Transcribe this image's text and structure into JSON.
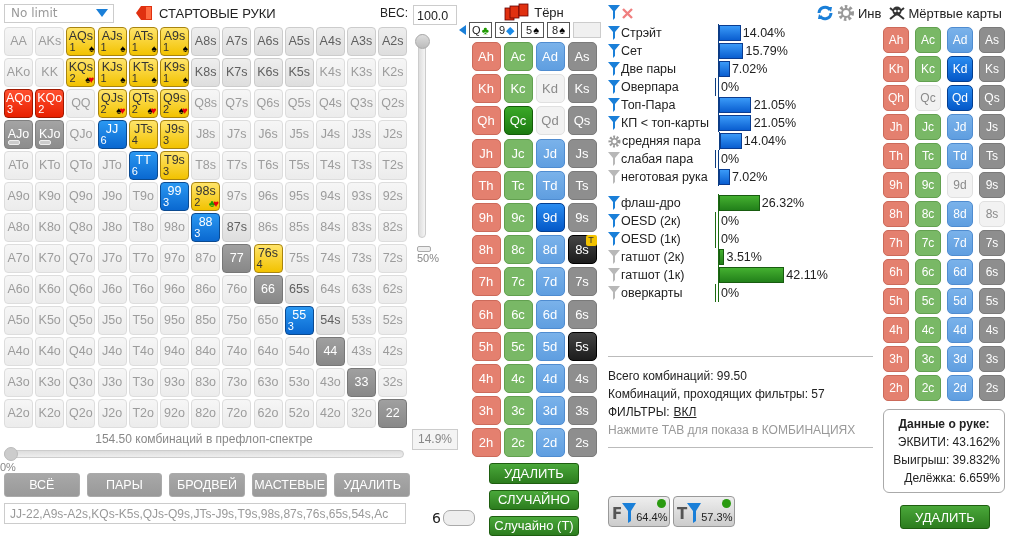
{
  "game_select": {
    "value": "No limit"
  },
  "range_title": "СТАРТОВЫЕ РУКИ",
  "weight": {
    "label": "ВЕС:",
    "value": "100.0"
  },
  "weight_slider": {
    "level": 1,
    "reading": "50%"
  },
  "grid": [
    [
      {
        "label": "AA",
        "kind": "out"
      },
      {
        "label": "AKs",
        "kind": "out"
      },
      {
        "label": "AQs",
        "kind": "made",
        "count": "1",
        "suits": [
          {
            "symbol": "♠",
            "color": "#000000"
          }
        ]
      },
      {
        "label": "AJs",
        "kind": "made",
        "count": "1",
        "suits": [
          {
            "symbol": "♠",
            "color": "#000000"
          }
        ]
      },
      {
        "label": "ATs",
        "kind": "made",
        "count": "1",
        "suits": [
          {
            "symbol": "♠",
            "color": "#000000"
          }
        ]
      },
      {
        "label": "A9s",
        "kind": "made",
        "count": "1",
        "suits": [
          {
            "symbol": "♠",
            "color": "#000000"
          }
        ]
      },
      {
        "label": "A8s",
        "kind": "in"
      },
      {
        "label": "A7s",
        "kind": "in"
      },
      {
        "label": "A6s",
        "kind": "in"
      },
      {
        "label": "A5s",
        "kind": "in"
      },
      {
        "label": "A4s",
        "kind": "in"
      },
      {
        "label": "A3s",
        "kind": "in"
      },
      {
        "label": "A2s",
        "kind": "in"
      }
    ],
    [
      {
        "label": "AKo",
        "kind": "out"
      },
      {
        "label": "KK",
        "kind": "out"
      },
      {
        "label": "KQs",
        "kind": "made",
        "count": "2",
        "suits": [
          {
            "symbol": "♠",
            "color": "#000000"
          },
          {
            "symbol": "♥",
            "color": "#e8000b"
          }
        ]
      },
      {
        "label": "KJs",
        "kind": "made",
        "count": "1",
        "suits": [
          {
            "symbol": "♠",
            "color": "#000000"
          }
        ]
      },
      {
        "label": "KTs",
        "kind": "made",
        "count": "1",
        "suits": [
          {
            "symbol": "♠",
            "color": "#000000"
          }
        ]
      },
      {
        "label": "K9s",
        "kind": "made",
        "count": "1",
        "suits": [
          {
            "symbol": "♠",
            "color": "#000000"
          }
        ]
      },
      {
        "label": "K8s",
        "kind": "in"
      },
      {
        "label": "K7s",
        "kind": "in"
      },
      {
        "label": "K6s",
        "kind": "in"
      },
      {
        "label": "K5s",
        "kind": "in"
      },
      {
        "label": "K4s",
        "kind": "out"
      },
      {
        "label": "K3s",
        "kind": "out"
      },
      {
        "label": "K2s",
        "kind": "out"
      }
    ],
    [
      {
        "label": "AQo",
        "kind": "offsuit",
        "count": "3"
      },
      {
        "label": "KQo",
        "kind": "offsuit",
        "count": "2"
      },
      {
        "label": "QQ",
        "kind": "out"
      },
      {
        "label": "QJs",
        "kind": "made",
        "count": "2",
        "suits": [
          {
            "symbol": "♠",
            "color": "#000000"
          },
          {
            "symbol": "♥",
            "color": "#e8000b"
          }
        ]
      },
      {
        "label": "QTs",
        "kind": "made",
        "count": "2",
        "suits": [
          {
            "symbol": "♠",
            "color": "#000000"
          },
          {
            "symbol": "♥",
            "color": "#e8000b"
          }
        ]
      },
      {
        "label": "Q9s",
        "kind": "made",
        "count": "2",
        "suits": [
          {
            "symbol": "♠",
            "color": "#000000"
          },
          {
            "symbol": "♥",
            "color": "#e8000b"
          }
        ]
      },
      {
        "label": "Q8s",
        "kind": "out"
      },
      {
        "label": "Q7s",
        "kind": "out"
      },
      {
        "label": "Q6s",
        "kind": "out"
      },
      {
        "label": "Q5s",
        "kind": "out"
      },
      {
        "label": "Q4s",
        "kind": "out"
      },
      {
        "label": "Q3s",
        "kind": "out"
      },
      {
        "label": "Q2s",
        "kind": "out"
      }
    ],
    [
      {
        "label": "AJo",
        "kind": "partial"
      },
      {
        "label": "KJo",
        "kind": "partial"
      },
      {
        "label": "QJo",
        "kind": "out"
      },
      {
        "label": "JJ",
        "kind": "pair",
        "count": "6"
      },
      {
        "label": "JTs",
        "kind": "made",
        "count": "4"
      },
      {
        "label": "J9s",
        "kind": "made",
        "count": "3"
      },
      {
        "label": "J8s",
        "kind": "out"
      },
      {
        "label": "J7s",
        "kind": "out"
      },
      {
        "label": "J6s",
        "kind": "out"
      },
      {
        "label": "J5s",
        "kind": "out"
      },
      {
        "label": "J4s",
        "kind": "out"
      },
      {
        "label": "J3s",
        "kind": "out"
      },
      {
        "label": "J2s",
        "kind": "out"
      }
    ],
    [
      {
        "label": "ATo",
        "kind": "out"
      },
      {
        "label": "KTo",
        "kind": "out"
      },
      {
        "label": "QTo",
        "kind": "out"
      },
      {
        "label": "JTo",
        "kind": "out"
      },
      {
        "label": "TT",
        "kind": "pair",
        "count": "6"
      },
      {
        "label": "T9s",
        "kind": "made",
        "count": "3"
      },
      {
        "label": "T8s",
        "kind": "out"
      },
      {
        "label": "T7s",
        "kind": "out"
      },
      {
        "label": "T6s",
        "kind": "out"
      },
      {
        "label": "T5s",
        "kind": "out"
      },
      {
        "label": "T4s",
        "kind": "out"
      },
      {
        "label": "T3s",
        "kind": "out"
      },
      {
        "label": "T2s",
        "kind": "out"
      }
    ],
    [
      {
        "label": "A9o",
        "kind": "out"
      },
      {
        "label": "K9o",
        "kind": "out"
      },
      {
        "label": "Q9o",
        "kind": "out"
      },
      {
        "label": "J9o",
        "kind": "out"
      },
      {
        "label": "T9o",
        "kind": "out"
      },
      {
        "label": "99",
        "kind": "pair",
        "count": "3"
      },
      {
        "label": "98s",
        "kind": "made",
        "count": "2",
        "suits": [
          {
            "symbol": "♣",
            "color": "#1e9a00"
          },
          {
            "symbol": "♥",
            "color": "#e8000b"
          }
        ]
      },
      {
        "label": "97s",
        "kind": "out"
      },
      {
        "label": "96s",
        "kind": "out"
      },
      {
        "label": "95s",
        "kind": "out"
      },
      {
        "label": "94s",
        "kind": "out"
      },
      {
        "label": "93s",
        "kind": "out"
      },
      {
        "label": "92s",
        "kind": "out"
      }
    ],
    [
      {
        "label": "A8o",
        "kind": "out"
      },
      {
        "label": "K8o",
        "kind": "out"
      },
      {
        "label": "Q8o",
        "kind": "out"
      },
      {
        "label": "J8o",
        "kind": "out"
      },
      {
        "label": "T8o",
        "kind": "out"
      },
      {
        "label": "98o",
        "kind": "out"
      },
      {
        "label": "88",
        "kind": "pair",
        "count": "3"
      },
      {
        "label": "87s",
        "kind": "in"
      },
      {
        "label": "86s",
        "kind": "out"
      },
      {
        "label": "85s",
        "kind": "out"
      },
      {
        "label": "84s",
        "kind": "out"
      },
      {
        "label": "83s",
        "kind": "out"
      },
      {
        "label": "82s",
        "kind": "out"
      }
    ],
    [
      {
        "label": "A7o",
        "kind": "out"
      },
      {
        "label": "K7o",
        "kind": "out"
      },
      {
        "label": "Q7o",
        "kind": "out"
      },
      {
        "label": "J7o",
        "kind": "out"
      },
      {
        "label": "T7o",
        "kind": "out"
      },
      {
        "label": "97o",
        "kind": "out"
      },
      {
        "label": "87o",
        "kind": "out"
      },
      {
        "label": "77",
        "kind": "blocked"
      },
      {
        "label": "76s",
        "kind": "made",
        "count": "4"
      },
      {
        "label": "75s",
        "kind": "out"
      },
      {
        "label": "74s",
        "kind": "out"
      },
      {
        "label": "73s",
        "kind": "out"
      },
      {
        "label": "72s",
        "kind": "out"
      }
    ],
    [
      {
        "label": "A6o",
        "kind": "out"
      },
      {
        "label": "K6o",
        "kind": "out"
      },
      {
        "label": "Q6o",
        "kind": "out"
      },
      {
        "label": "J6o",
        "kind": "out"
      },
      {
        "label": "T6o",
        "kind": "out"
      },
      {
        "label": "96o",
        "kind": "out"
      },
      {
        "label": "86o",
        "kind": "out"
      },
      {
        "label": "76o",
        "kind": "out"
      },
      {
        "label": "66",
        "kind": "blocked"
      },
      {
        "label": "65s",
        "kind": "in"
      },
      {
        "label": "64s",
        "kind": "out"
      },
      {
        "label": "63s",
        "kind": "out"
      },
      {
        "label": "62s",
        "kind": "out"
      }
    ],
    [
      {
        "label": "A5o",
        "kind": "out"
      },
      {
        "label": "K5o",
        "kind": "out"
      },
      {
        "label": "Q5o",
        "kind": "out"
      },
      {
        "label": "J5o",
        "kind": "out"
      },
      {
        "label": "T5o",
        "kind": "out"
      },
      {
        "label": "95o",
        "kind": "out"
      },
      {
        "label": "85o",
        "kind": "out"
      },
      {
        "label": "75o",
        "kind": "out"
      },
      {
        "label": "65o",
        "kind": "out"
      },
      {
        "label": "55",
        "kind": "pair",
        "count": "3"
      },
      {
        "label": "54s",
        "kind": "in"
      },
      {
        "label": "53s",
        "kind": "out"
      },
      {
        "label": "52s",
        "kind": "out"
      }
    ],
    [
      {
        "label": "A4o",
        "kind": "out"
      },
      {
        "label": "K4o",
        "kind": "out"
      },
      {
        "label": "Q4o",
        "kind": "out"
      },
      {
        "label": "J4o",
        "kind": "out"
      },
      {
        "label": "T4o",
        "kind": "out"
      },
      {
        "label": "94o",
        "kind": "out"
      },
      {
        "label": "84o",
        "kind": "out"
      },
      {
        "label": "74o",
        "kind": "out"
      },
      {
        "label": "64o",
        "kind": "out"
      },
      {
        "label": "54o",
        "kind": "out"
      },
      {
        "label": "44",
        "kind": "blocked"
      },
      {
        "label": "43s",
        "kind": "out"
      },
      {
        "label": "42s",
        "kind": "out"
      }
    ],
    [
      {
        "label": "A3o",
        "kind": "out"
      },
      {
        "label": "K3o",
        "kind": "out"
      },
      {
        "label": "Q3o",
        "kind": "out"
      },
      {
        "label": "J3o",
        "kind": "out"
      },
      {
        "label": "T3o",
        "kind": "out"
      },
      {
        "label": "93o",
        "kind": "out"
      },
      {
        "label": "83o",
        "kind": "out"
      },
      {
        "label": "73o",
        "kind": "out"
      },
      {
        "label": "63o",
        "kind": "out"
      },
      {
        "label": "53o",
        "kind": "out"
      },
      {
        "label": "43o",
        "kind": "out"
      },
      {
        "label": "33",
        "kind": "blocked"
      },
      {
        "label": "32s",
        "kind": "out"
      }
    ],
    [
      {
        "label": "A2o",
        "kind": "out"
      },
      {
        "label": "K2o",
        "kind": "out"
      },
      {
        "label": "Q2o",
        "kind": "out"
      },
      {
        "label": "J2o",
        "kind": "out"
      },
      {
        "label": "T2o",
        "kind": "out"
      },
      {
        "label": "92o",
        "kind": "out"
      },
      {
        "label": "82o",
        "kind": "out"
      },
      {
        "label": "72o",
        "kind": "out"
      },
      {
        "label": "62o",
        "kind": "out"
      },
      {
        "label": "52o",
        "kind": "out"
      },
      {
        "label": "42o",
        "kind": "out"
      },
      {
        "label": "32o",
        "kind": "out"
      },
      {
        "label": "22",
        "kind": "blocked"
      }
    ]
  ],
  "combos_caption": "154.50 комбинаций в префлоп-спектре",
  "range_slider": {
    "level": 0,
    "reading": "0%",
    "field": "14.9%"
  },
  "range_buttons": [
    "ВСЁ",
    "ПАРЫ",
    "БРОДВЕЙ",
    "МАСТЕВЫЕ",
    "УДАЛИТЬ"
  ],
  "range_text": "JJ-22,A9s-A2s,KQs-K5s,QJs-Q9s,JTs-J9s,T9s,98s,87s,76s,65s,54s,Ac",
  "street": "Тёрн",
  "board": [
    {
      "rank": "Q",
      "kind": "clubs",
      "symbol": "♣"
    },
    {
      "rank": "9",
      "kind": "diamonds",
      "symbol": "◆"
    },
    {
      "rank": "5",
      "kind": "spades",
      "symbol": "♠"
    },
    {
      "rank": "8",
      "kind": "spades",
      "symbol": "♠"
    }
  ],
  "board_cards": [
    [
      {
        "label": "Ah",
        "kind": "hearts",
        "selected": false,
        "dead": false
      },
      {
        "label": "Ac",
        "kind": "clubs",
        "selected": false,
        "dead": false
      },
      {
        "label": "Ad",
        "kind": "diamonds",
        "selected": false,
        "dead": false
      },
      {
        "label": "As",
        "kind": "spades",
        "selected": false,
        "dead": false
      }
    ],
    [
      {
        "label": "Kh",
        "kind": "hearts",
        "selected": false,
        "dead": false
      },
      {
        "label": "Kc",
        "kind": "clubs",
        "selected": false,
        "dead": false
      },
      {
        "label": "Kd",
        "kind": "diamonds",
        "selected": false,
        "dead": true
      },
      {
        "label": "Ks",
        "kind": "spades",
        "selected": false,
        "dead": false
      }
    ],
    [
      {
        "label": "Qh",
        "kind": "hearts",
        "selected": false,
        "dead": false
      },
      {
        "label": "Qc",
        "kind": "clubs",
        "selected": true,
        "dead": false
      },
      {
        "label": "Qd",
        "kind": "diamonds",
        "selected": false,
        "dead": true
      },
      {
        "label": "Qs",
        "kind": "spades",
        "selected": false,
        "dead": false
      }
    ],
    [
      {
        "label": "Jh",
        "kind": "hearts",
        "selected": false,
        "dead": false
      },
      {
        "label": "Jc",
        "kind": "clubs",
        "selected": false,
        "dead": false
      },
      {
        "label": "Jd",
        "kind": "diamonds",
        "selected": false,
        "dead": false
      },
      {
        "label": "Js",
        "kind": "spades",
        "selected": false,
        "dead": false
      }
    ],
    [
      {
        "label": "Th",
        "kind": "hearts",
        "selected": false,
        "dead": false
      },
      {
        "label": "Tc",
        "kind": "clubs",
        "selected": false,
        "dead": false
      },
      {
        "label": "Td",
        "kind": "diamonds",
        "selected": false,
        "dead": false
      },
      {
        "label": "Ts",
        "kind": "spades",
        "selected": false,
        "dead": false
      }
    ],
    [
      {
        "label": "9h",
        "kind": "hearts",
        "selected": false,
        "dead": false
      },
      {
        "label": "9c",
        "kind": "clubs",
        "selected": false,
        "dead": false
      },
      {
        "label": "9d",
        "kind": "diamonds",
        "selected": true,
        "dead": false
      },
      {
        "label": "9s",
        "kind": "spades",
        "selected": false,
        "dead": false
      }
    ],
    [
      {
        "label": "8h",
        "kind": "hearts",
        "selected": false,
        "dead": false
      },
      {
        "label": "8c",
        "kind": "clubs",
        "selected": false,
        "dead": false
      },
      {
        "label": "8d",
        "kind": "diamonds",
        "selected": false,
        "dead": false
      },
      {
        "label": "8s",
        "kind": "spades",
        "selected": true,
        "dead": false,
        "badge": "T"
      }
    ],
    [
      {
        "label": "7h",
        "kind": "hearts",
        "selected": false,
        "dead": false
      },
      {
        "label": "7c",
        "kind": "clubs",
        "selected": false,
        "dead": false
      },
      {
        "label": "7d",
        "kind": "diamonds",
        "selected": false,
        "dead": false
      },
      {
        "label": "7s",
        "kind": "spades",
        "selected": false,
        "dead": false
      }
    ],
    [
      {
        "label": "6h",
        "kind": "hearts",
        "selected": false,
        "dead": false
      },
      {
        "label": "6c",
        "kind": "clubs",
        "selected": false,
        "dead": false
      },
      {
        "label": "6d",
        "kind": "diamonds",
        "selected": false,
        "dead": false
      },
      {
        "label": "6s",
        "kind": "spades",
        "selected": false,
        "dead": false
      }
    ],
    [
      {
        "label": "5h",
        "kind": "hearts",
        "selected": false,
        "dead": false
      },
      {
        "label": "5c",
        "kind": "clubs",
        "selected": false,
        "dead": false
      },
      {
        "label": "5d",
        "kind": "diamonds",
        "selected": false,
        "dead": false
      },
      {
        "label": "5s",
        "kind": "spades",
        "selected": true,
        "dead": false
      }
    ],
    [
      {
        "label": "4h",
        "kind": "hearts",
        "selected": false,
        "dead": false
      },
      {
        "label": "4c",
        "kind": "clubs",
        "selected": false,
        "dead": false
      },
      {
        "label": "4d",
        "kind": "diamonds",
        "selected": false,
        "dead": false
      },
      {
        "label": "4s",
        "kind": "spades",
        "selected": false,
        "dead": false
      }
    ],
    [
      {
        "label": "3h",
        "kind": "hearts",
        "selected": false,
        "dead": false
      },
      {
        "label": "3c",
        "kind": "clubs",
        "selected": false,
        "dead": false
      },
      {
        "label": "3d",
        "kind": "diamonds",
        "selected": false,
        "dead": false
      },
      {
        "label": "3s",
        "kind": "spades",
        "selected": false,
        "dead": false
      }
    ],
    [
      {
        "label": "2h",
        "kind": "hearts",
        "selected": false,
        "dead": false
      },
      {
        "label": "2c",
        "kind": "clubs",
        "selected": false,
        "dead": false
      },
      {
        "label": "2d",
        "kind": "diamonds",
        "selected": false,
        "dead": false
      },
      {
        "label": "2s",
        "kind": "spades",
        "selected": false,
        "dead": false
      }
    ]
  ],
  "board_buttons": [
    "УДАЛИТЬ",
    "СЛУЧАЙНО",
    "Случайно (Т)"
  ],
  "toggle": {
    "label": "6",
    "on": false
  },
  "made_hands": [
    {
      "label": "Стрэйт",
      "kind": "on",
      "level": 0.1404,
      "value": "14.04%"
    },
    {
      "label": "Сет",
      "kind": "on",
      "level": 0.1579,
      "value": "15.79%"
    },
    {
      "label": "Две пары",
      "kind": "on",
      "level": 0.0702,
      "value": "7.02%"
    },
    {
      "label": "Оверпара",
      "kind": "on",
      "level": 0,
      "value": "0%"
    },
    {
      "label": "Топ-Пара",
      "kind": "on",
      "level": 0.2105,
      "value": "21.05%"
    },
    {
      "label": "КП < топ-карты",
      "kind": "on",
      "level": 0.2105,
      "value": "21.05%"
    },
    {
      "label": "средняя пара",
      "kind": "gear",
      "level": 0.1404,
      "value": "14.04%"
    },
    {
      "label": "слабая пара",
      "kind": "off",
      "level": 0,
      "value": "0%"
    },
    {
      "label": "неготовая рука",
      "kind": "off",
      "level": 0.0702,
      "value": "7.02%"
    }
  ],
  "draws": [
    {
      "label": "флаш-дро",
      "kind": "on",
      "level": 0.2632,
      "value": "26.32%"
    },
    {
      "label": "OESD (2к)",
      "kind": "on",
      "level": 0,
      "value": "0%"
    },
    {
      "label": "OESD (1к)",
      "kind": "on",
      "level": 0,
      "value": "0%"
    },
    {
      "label": "гатшот (2к)",
      "kind": "off",
      "level": 0.0351,
      "value": "3.51%"
    },
    {
      "label": "гатшот (1к)",
      "kind": "off",
      "level": 0.4211,
      "value": "42.11%"
    },
    {
      "label": "оверкарты",
      "kind": "off",
      "level": 0,
      "value": "0%"
    }
  ],
  "summary": {
    "total": "Всего комбинаций: 99.50",
    "passing": "Комбинаций, проходящих фильтры: 57",
    "filters_label": "ФИЛЬТРЫ:",
    "filters_link": "ВКЛ",
    "hint": "Нажмите TAB для показа в КОМБИНАЦИЯХ"
  },
  "filter_badges": [
    {
      "letter": "F",
      "value": "64.4%",
      "on": true
    },
    {
      "letter": "T",
      "value": "57.3%",
      "on": true
    }
  ],
  "invert_label": "Инв",
  "dead_title": "Мёртвые карты",
  "dead_cards": [
    [
      {
        "label": "Ah",
        "kind": "hearts",
        "selected": false,
        "dead": false
      },
      {
        "label": "Ac",
        "kind": "clubs",
        "selected": false,
        "dead": false
      },
      {
        "label": "Ad",
        "kind": "diamonds",
        "selected": false,
        "dead": false
      },
      {
        "label": "As",
        "kind": "spades",
        "selected": false,
        "dead": false
      }
    ],
    [
      {
        "label": "Kh",
        "kind": "hearts",
        "selected": false,
        "dead": false
      },
      {
        "label": "Kc",
        "kind": "clubs",
        "selected": false,
        "dead": false
      },
      {
        "label": "Kd",
        "kind": "diamonds",
        "selected": true,
        "dead": false
      },
      {
        "label": "Ks",
        "kind": "spades",
        "selected": false,
        "dead": false
      }
    ],
    [
      {
        "label": "Qh",
        "kind": "hearts",
        "selected": false,
        "dead": false
      },
      {
        "label": "Qc",
        "kind": "clubs",
        "selected": false,
        "dead": true
      },
      {
        "label": "Qd",
        "kind": "diamonds",
        "selected": true,
        "dead": false
      },
      {
        "label": "Qs",
        "kind": "spades",
        "selected": false,
        "dead": false
      }
    ],
    [
      {
        "label": "Jh",
        "kind": "hearts",
        "selected": false,
        "dead": false
      },
      {
        "label": "Jc",
        "kind": "clubs",
        "selected": false,
        "dead": false
      },
      {
        "label": "Jd",
        "kind": "diamonds",
        "selected": false,
        "dead": false
      },
      {
        "label": "Js",
        "kind": "spades",
        "selected": false,
        "dead": false
      }
    ],
    [
      {
        "label": "Th",
        "kind": "hearts",
        "selected": false,
        "dead": false
      },
      {
        "label": "Tc",
        "kind": "clubs",
        "selected": false,
        "dead": false
      },
      {
        "label": "Td",
        "kind": "diamonds",
        "selected": false,
        "dead": false
      },
      {
        "label": "Ts",
        "kind": "spades",
        "selected": false,
        "dead": false
      }
    ],
    [
      {
        "label": "9h",
        "kind": "hearts",
        "selected": false,
        "dead": false
      },
      {
        "label": "9c",
        "kind": "clubs",
        "selected": false,
        "dead": false
      },
      {
        "label": "9d",
        "kind": "diamonds",
        "selected": false,
        "dead": true
      },
      {
        "label": "9s",
        "kind": "spades",
        "selected": false,
        "dead": false
      }
    ],
    [
      {
        "label": "8h",
        "kind": "hearts",
        "selected": false,
        "dead": false
      },
      {
        "label": "8c",
        "kind": "clubs",
        "selected": false,
        "dead": false
      },
      {
        "label": "8d",
        "kind": "diamonds",
        "selected": false,
        "dead": false
      },
      {
        "label": "8s",
        "kind": "spades",
        "selected": false,
        "dead": true
      }
    ],
    [
      {
        "label": "7h",
        "kind": "hearts",
        "selected": false,
        "dead": false
      },
      {
        "label": "7c",
        "kind": "clubs",
        "selected": false,
        "dead": false
      },
      {
        "label": "7d",
        "kind": "diamonds",
        "selected": false,
        "dead": false
      },
      {
        "label": "7s",
        "kind": "spades",
        "selected": false,
        "dead": false
      }
    ],
    [
      {
        "label": "6h",
        "kind": "hearts",
        "selected": false,
        "dead": false
      },
      {
        "label": "6c",
        "kind": "clubs",
        "selected": false,
        "dead": false
      },
      {
        "label": "6d",
        "kind": "diamonds",
        "selected": false,
        "dead": false
      },
      {
        "label": "6s",
        "kind": "spades",
        "selected": false,
        "dead": false
      }
    ],
    [
      {
        "label": "5h",
        "kind": "hearts",
        "selected": false,
        "dead": false
      },
      {
        "label": "5c",
        "kind": "clubs",
        "selected": false,
        "dead": false
      },
      {
        "label": "5d",
        "kind": "diamonds",
        "selected": false,
        "dead": false
      },
      {
        "label": "5s",
        "kind": "spades",
        "selected": false,
        "dead": false
      }
    ],
    [
      {
        "label": "4h",
        "kind": "hearts",
        "selected": false,
        "dead": false
      },
      {
        "label": "4c",
        "kind": "clubs",
        "selected": false,
        "dead": false
      },
      {
        "label": "4d",
        "kind": "diamonds",
        "selected": false,
        "dead": false
      },
      {
        "label": "4s",
        "kind": "spades",
        "selected": false,
        "dead": false
      }
    ],
    [
      {
        "label": "3h",
        "kind": "hearts",
        "selected": false,
        "dead": false
      },
      {
        "label": "3c",
        "kind": "clubs",
        "selected": false,
        "dead": false
      },
      {
        "label": "3d",
        "kind": "diamonds",
        "selected": false,
        "dead": false
      },
      {
        "label": "3s",
        "kind": "spades",
        "selected": false,
        "dead": false
      }
    ],
    [
      {
        "label": "2h",
        "kind": "hearts",
        "selected": false,
        "dead": false
      },
      {
        "label": "2c",
        "kind": "clubs",
        "selected": false,
        "dead": false
      },
      {
        "label": "2d",
        "kind": "diamonds",
        "selected": false,
        "dead": false
      },
      {
        "label": "2s",
        "kind": "spades",
        "selected": false,
        "dead": false
      }
    ]
  ],
  "hand_data": {
    "title": "Данные о руке:",
    "lines": [
      "ЭКВИТИ: 43.162%",
      "Выигрыш: 39.832%",
      "Делёжка: 6.659%"
    ]
  },
  "dead_button": "УДАЛИТЬ"
}
